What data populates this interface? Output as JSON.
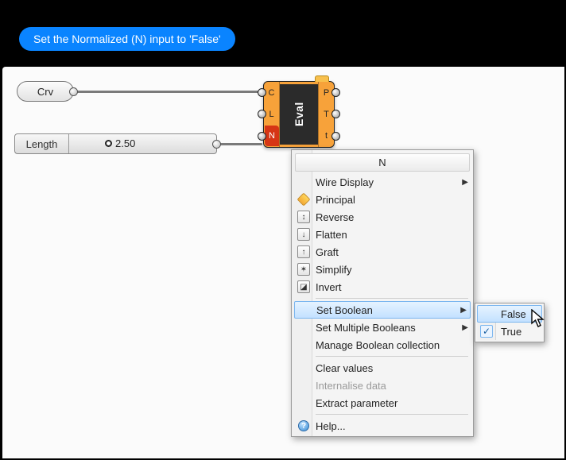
{
  "instruction": "Set the Normalized (N) input to 'False'",
  "nodes": {
    "crv_label": "Crv",
    "slider_label": "Length",
    "slider_value": "2.50",
    "eval_label": "Eval",
    "eval_inputs": [
      "C",
      "L",
      "N"
    ],
    "eval_outputs": [
      "P",
      "T",
      "t"
    ]
  },
  "context_menu": {
    "title": "N",
    "items": {
      "wire_display": "Wire Display",
      "principal": "Principal",
      "reverse": "Reverse",
      "flatten": "Flatten",
      "graft": "Graft",
      "simplify": "Simplify",
      "invert": "Invert",
      "set_boolean": "Set Boolean",
      "set_multiple": "Set Multiple Booleans",
      "manage_collection": "Manage Boolean collection",
      "clear_values": "Clear values",
      "internalise": "Internalise data",
      "extract_param": "Extract parameter",
      "help": "Help..."
    }
  },
  "submenu": {
    "false_label": "False",
    "true_label": "True",
    "current_value": "True"
  }
}
